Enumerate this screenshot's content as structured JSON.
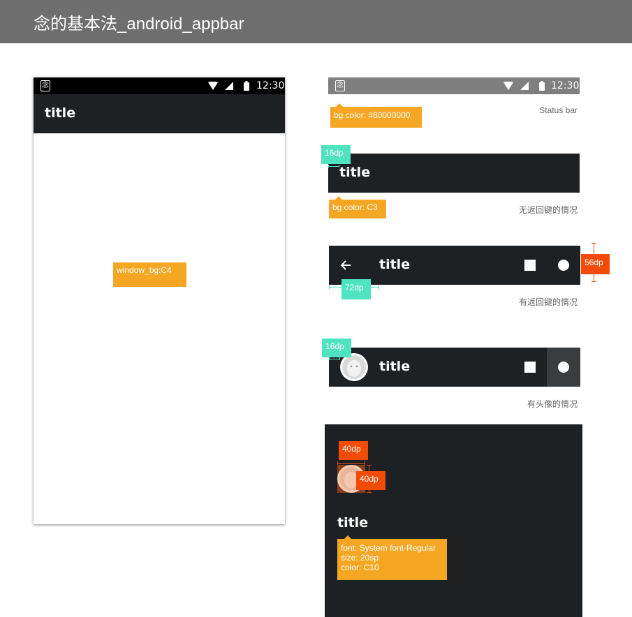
{
  "page": {
    "title": "念的基本法_android_appbar"
  },
  "phone": {
    "status_bar": {
      "app_icon_glyph": "念",
      "time": "12:30"
    },
    "appbar": {
      "title": "title"
    },
    "window_tag": "window_bg:C4"
  },
  "specs": {
    "status_bar": {
      "app_icon_glyph": "念",
      "time": "12:30",
      "bg_tag": "bg color: #80000000",
      "caption": "Status  bar"
    },
    "appbar_plain": {
      "title": "title",
      "margin_tag": "16dp",
      "bg_tag": "bg color: C3",
      "caption": "无返回键的情况"
    },
    "appbar_back": {
      "title": "title",
      "offset_tag": "72dp",
      "height_tag": "56dp",
      "caption": "有返回键的情况"
    },
    "appbar_avatar": {
      "title": "title",
      "margin_tag": "16dp",
      "caption": "有头像的情况"
    },
    "avatar_detail": {
      "width_tag": "40dp",
      "height_tag": "40dp",
      "title": "title",
      "font_tag_lines": [
        "font: System font-Regular",
        "size: 20sp",
        "color: C10"
      ]
    }
  },
  "colors": {
    "header_bg": "#6e6e6e",
    "appbar_bg": "#1e2124",
    "tag_orange": "#f5a623",
    "tag_teal": "#4fe3c1",
    "tag_red": "#f24b06"
  }
}
